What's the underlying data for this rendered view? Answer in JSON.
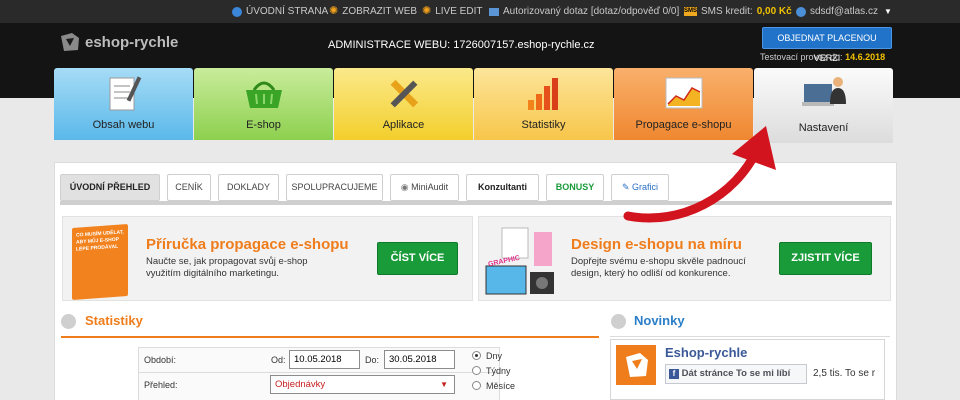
{
  "topbar": {
    "home": "ÚVODNÍ STRANA",
    "view": "ZOBRAZIT WEB",
    "live": "LIVE EDIT",
    "query": "Autorizovaný dotaz [dotaz/odpověď 0/0]",
    "sms_label": "SMS kredit:",
    "sms_value": "0,00 Kč",
    "user": "sdsdf@atlas.cz"
  },
  "header": {
    "logo": "eshop-rychle",
    "admin": "ADMINISTRACE WEBU: 1726007157.eshop-rychle.cz",
    "order_button": "OBJEDNAT PLACENOU VERZI",
    "trial_label": "Testovací provoz do:",
    "trial_date": "14.6.2018"
  },
  "tiles": [
    "Obsah webu",
    "E-shop",
    "Aplikace",
    "Statistiky",
    "Propagace e-shopu",
    "Nastavení"
  ],
  "tabs": [
    "ÚVODNÍ PŘEHLED",
    "CENÍK",
    "DOKLADY",
    "SPOLUPRACUJEME",
    "MiniAudit",
    "Konzultanti",
    "BONUSY",
    "Grafici"
  ],
  "promo1": {
    "title": "Příručka propagace e-shopu",
    "text": "Naučte se, jak propagovat svůj e-shop využitím digitálního marketingu.",
    "button": "ČÍST VÍCE",
    "book": "CO MUSÍM UDĚLAT, ABY MŮJ E-SHOP LÉPE PRODÁVAL"
  },
  "promo2": {
    "title": "Design e-shopu na míru",
    "text": "Dopřejte svému e-shopu skvěle padnoucí design, který ho odliší od konkurence.",
    "button": "ZJISTIT VÍCE",
    "graphic": "GRAPHIC"
  },
  "stats": {
    "title": "Statistiky",
    "period_label": "Období:",
    "from_label": "Od:",
    "from_value": "10.05.2018",
    "to_label": "Do:",
    "to_value": "30.05.2018",
    "overview_label": "Přehled:",
    "overview_value": "Objednávky",
    "radios": [
      "Dny",
      "Týdny",
      "Měsíce"
    ],
    "radio_selected": "Dny"
  },
  "news": {
    "title": "Novinky",
    "fb_name": "Eshop-rychle",
    "like_button": "Dát stránce To se mi líbí",
    "like_count": "2,5 tis. To se r"
  },
  "colors": {
    "accent_orange": "#f07d1c",
    "green_button": "#1a9b3a",
    "blue_button": "#2173c9",
    "arrow_red": "#d2141e"
  }
}
